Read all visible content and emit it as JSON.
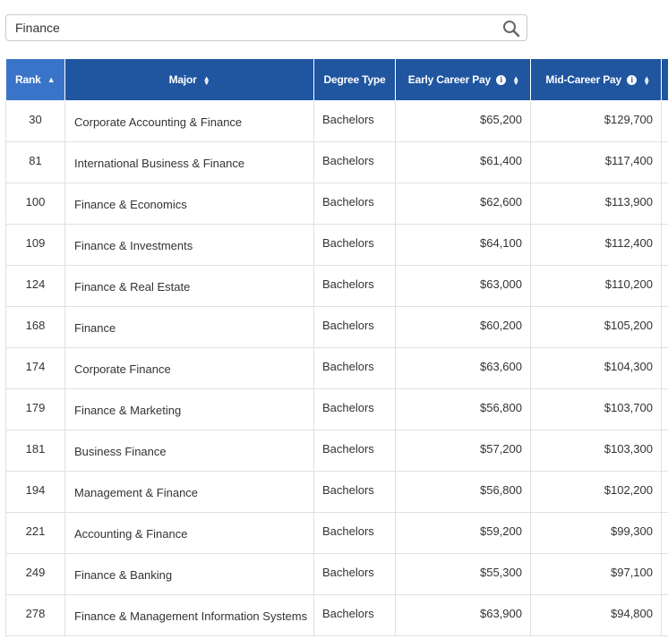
{
  "search": {
    "value": "Finance",
    "placeholder": ""
  },
  "table": {
    "headers": {
      "rank": "Rank",
      "major": "Major",
      "degree": "Degree Type",
      "early": "Early Career Pay",
      "mid": "Mid-Career Pay"
    },
    "rows": [
      {
        "rank": "30",
        "major": "Corporate Accounting & Finance",
        "degree": "Bachelors",
        "early": "$65,200",
        "mid": "$129,700"
      },
      {
        "rank": "81",
        "major": "International Business & Finance",
        "degree": "Bachelors",
        "early": "$61,400",
        "mid": "$117,400"
      },
      {
        "rank": "100",
        "major": "Finance & Economics",
        "degree": "Bachelors",
        "early": "$62,600",
        "mid": "$113,900"
      },
      {
        "rank": "109",
        "major": "Finance & Investments",
        "degree": "Bachelors",
        "early": "$64,100",
        "mid": "$112,400"
      },
      {
        "rank": "124",
        "major": "Finance & Real Estate",
        "degree": "Bachelors",
        "early": "$63,000",
        "mid": "$110,200"
      },
      {
        "rank": "168",
        "major": "Finance",
        "degree": "Bachelors",
        "early": "$60,200",
        "mid": "$105,200"
      },
      {
        "rank": "174",
        "major": "Corporate Finance",
        "degree": "Bachelors",
        "early": "$63,600",
        "mid": "$104,300"
      },
      {
        "rank": "179",
        "major": "Finance & Marketing",
        "degree": "Bachelors",
        "early": "$56,800",
        "mid": "$103,700"
      },
      {
        "rank": "181",
        "major": "Business Finance",
        "degree": "Bachelors",
        "early": "$57,200",
        "mid": "$103,300"
      },
      {
        "rank": "194",
        "major": "Management & Finance",
        "degree": "Bachelors",
        "early": "$56,800",
        "mid": "$102,200"
      },
      {
        "rank": "221",
        "major": "Accounting & Finance",
        "degree": "Bachelors",
        "early": "$59,200",
        "mid": "$99,300"
      },
      {
        "rank": "249",
        "major": "Finance & Banking",
        "degree": "Bachelors",
        "early": "$55,300",
        "mid": "$97,100"
      },
      {
        "rank": "278",
        "major": "Finance & Management Information Systems",
        "degree": "Bachelors",
        "early": "$63,900",
        "mid": "$94,800"
      }
    ]
  },
  "icons": {
    "search": "search-icon",
    "sort": "sort-icon",
    "info": "info-icon"
  },
  "colors": {
    "header_bg": "#2055a0",
    "header_active_bg": "#3a74c8",
    "header_text": "#ffffff",
    "border": "#e0e0e0"
  }
}
